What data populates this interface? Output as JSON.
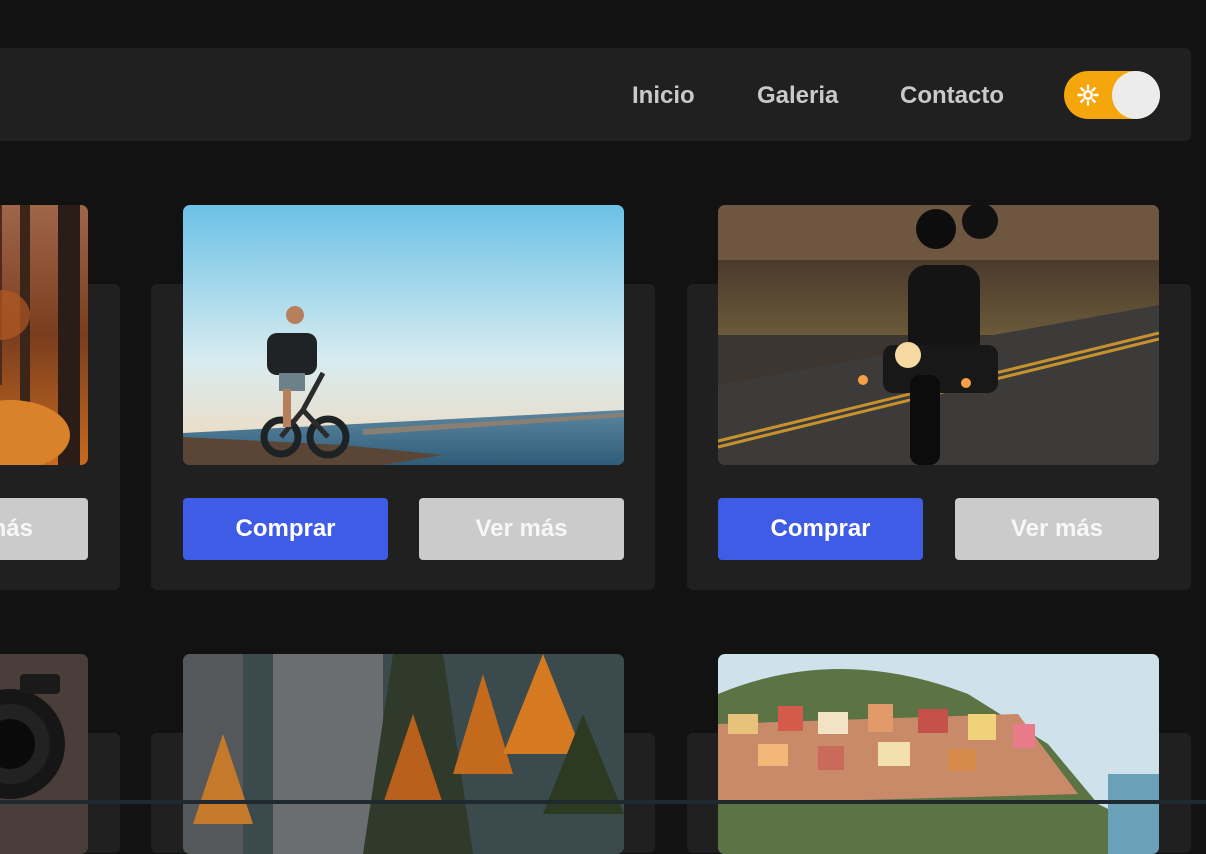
{
  "nav": {
    "links": [
      "Inicio",
      "Galeria",
      "Contacto"
    ],
    "theme_toggle": {
      "icon": "sun-icon",
      "state": "on",
      "accent": "#f5a60d"
    }
  },
  "cards": {
    "row1": [
      {
        "image": "autumn-forest",
        "more_label": "Ver más"
      },
      {
        "image": "man-on-ebike-beach",
        "buy_label": "Comprar",
        "more_label": "Ver más"
      },
      {
        "image": "motorcycle-night-road",
        "buy_label": "Comprar",
        "more_label": "Ver más"
      }
    ],
    "row2": [
      {
        "image": "camera-lens"
      },
      {
        "image": "autumn-cliff-trees"
      },
      {
        "image": "colorful-hillside-village"
      }
    ]
  },
  "colors": {
    "buy": "#3e5ce6",
    "more": "#cbcbcb",
    "card": "#202020",
    "background": "#121212"
  }
}
